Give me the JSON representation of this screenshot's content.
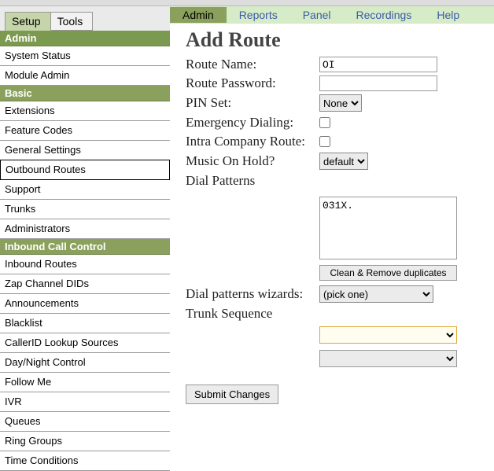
{
  "leftTabs": {
    "setup": "Setup",
    "tools": "Tools"
  },
  "sections": {
    "admin": "Admin",
    "basic": "Basic",
    "inbound": "Inbound Call Control"
  },
  "menu": {
    "systemStatus": "System Status",
    "moduleAdmin": "Module Admin",
    "extensions": "Extensions",
    "featureCodes": "Feature Codes",
    "generalSettings": "General Settings",
    "outboundRoutes": "Outbound Routes",
    "support": "Support",
    "trunks": "Trunks",
    "administrators": "Administrators",
    "inboundRoutes": "Inbound Routes",
    "zapChannelDIDs": "Zap Channel DIDs",
    "announcements": "Announcements",
    "blacklist": "Blacklist",
    "callerIdLookup": "CallerID Lookup Sources",
    "dayNightControl": "Day/Night Control",
    "followMe": "Follow Me",
    "ivr": "IVR",
    "queues": "Queues",
    "ringGroups": "Ring Groups",
    "timeConditions": "Time Conditions"
  },
  "topNav": {
    "admin": "Admin",
    "reports": "Reports",
    "panel": "Panel",
    "recordings": "Recordings",
    "help": "Help"
  },
  "page": {
    "title": "Add Route",
    "routeName": "Route Name:",
    "routeNameValue": "OI",
    "routePassword": "Route Password:",
    "routePasswordValue": "",
    "pinSet": "PIN Set:",
    "pinSetValue": "None",
    "emergency": "Emergency Dialing:",
    "intra": "Intra Company Route:",
    "moh": "Music On Hold?",
    "mohValue": "default",
    "dialPatterns": "Dial Patterns",
    "dialPatternsValue": "031X.",
    "cleanBtn": "Clean & Remove duplicates",
    "wizards": "Dial patterns wizards:",
    "wizardsValue": "(pick one)",
    "trunkSeq": "Trunk Sequence",
    "trunk1Value": "",
    "trunk2Value": "",
    "submit": "Submit Changes"
  }
}
